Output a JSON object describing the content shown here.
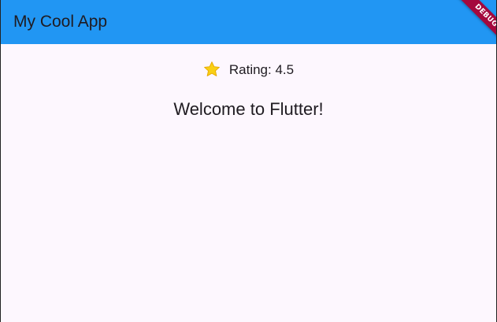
{
  "app_bar": {
    "title": "My Cool App",
    "color": "#2196f3"
  },
  "content": {
    "rating_icon": "star-icon",
    "rating_text": "Rating: 4.5",
    "welcome_text": "Welcome to Flutter!"
  },
  "debug_banner": {
    "label": "DEBUG",
    "color": "#a4093d"
  },
  "colors": {
    "background": "#fdf7fe",
    "text": "#1f1b21",
    "star": "#f7c600"
  }
}
